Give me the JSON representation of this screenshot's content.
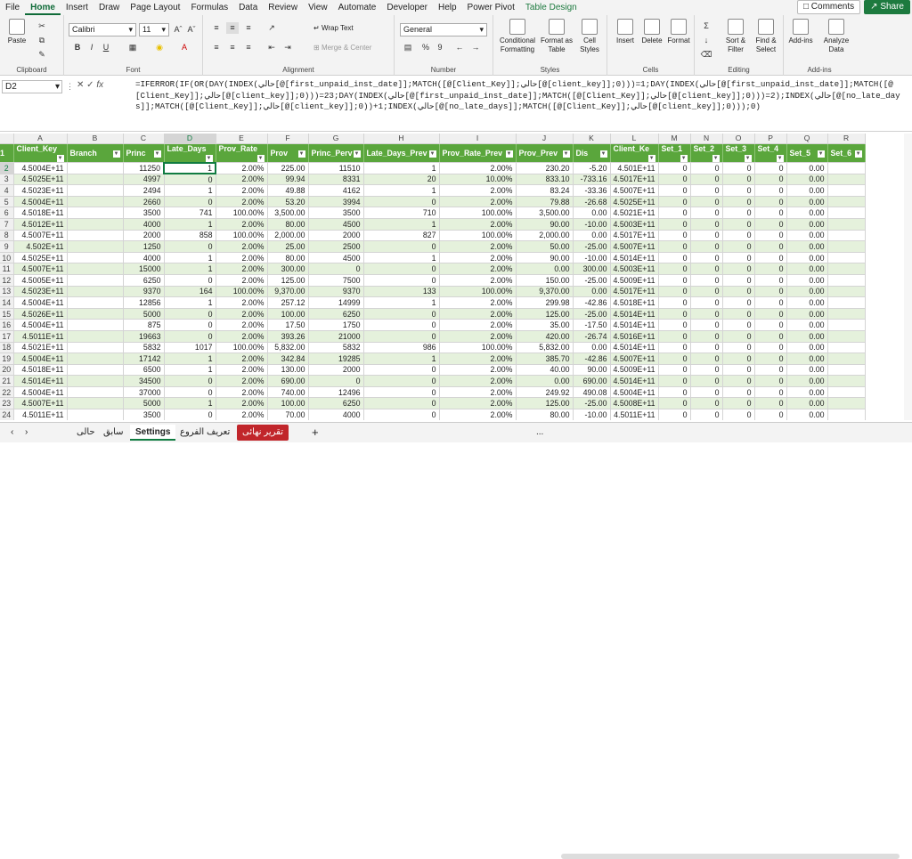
{
  "menu": {
    "tabs": [
      "File",
      "Home",
      "Insert",
      "Draw",
      "Page Layout",
      "Formulas",
      "Data",
      "Review",
      "View",
      "Automate",
      "Developer",
      "Help",
      "Power Pivot",
      "Table Design"
    ],
    "active": "Home",
    "comments": "Comments",
    "share": "Share"
  },
  "ribbon": {
    "clipboard": {
      "label": "Clipboard",
      "paste": "Paste"
    },
    "font": {
      "label": "Font",
      "name": "Calibri",
      "size": "11"
    },
    "alignment": {
      "label": "Alignment",
      "wrap": "Wrap Text",
      "merge": "Merge & Center"
    },
    "number": {
      "label": "Number",
      "format": "General",
      "pct": "%",
      "comma": "9"
    },
    "styles": {
      "label": "Styles",
      "cond": "Conditional Formatting",
      "fmt_table": "Format as Table",
      "cell_styles": "Cell Styles"
    },
    "cells": {
      "label": "Cells",
      "insert": "Insert",
      "delete": "Delete",
      "format": "Format"
    },
    "editing": {
      "label": "Editing",
      "sort": "Sort & Filter",
      "find": "Find & Select"
    },
    "addins": {
      "label": "Add-ins",
      "addins": "Add-ins",
      "analyze": "Analyze Data"
    }
  },
  "formula_bar": {
    "name_box": "D2",
    "fx": "fx",
    "formula": "=IFERROR(IF(OR(DAY(INDEX(حالي[@[first_unpaid_inst_date]];MATCH([@[Client_Key]];حالي[@[client_key]];0)))=1;DAY(INDEX(حالي[@[first_unpaid_inst_date]];MATCH([@[Client_Key]];حالي[@[client_key]];0)))=23;DAY(INDEX(حالي[@[first_unpaid_inst_date]];MATCH([@[Client_Key]];حالي[@[client_key]];0)))=2);INDEX(حالي[@[no_late_days]];MATCH([@[Client_Key]];حالي[@[client_key]];0))+1;INDEX(حالي[@[no_late_days]];MATCH([@[Client_Key]];حالي[@[client_key]];0)));0)"
  },
  "grid": {
    "columns": [
      "A",
      "B",
      "C",
      "D",
      "E",
      "F",
      "G",
      "H",
      "I",
      "J",
      "K",
      "L",
      "M",
      "N",
      "O",
      "P",
      "Q",
      "R"
    ],
    "headers": [
      "Client_Key",
      "Branch",
      "Princ",
      "Late_Days",
      "Prov_Rate",
      "Prov",
      "Princ_Perv",
      "Late_Days_Prev",
      "Prov_Rate_Prev",
      "Prov_Prev",
      "Dis",
      "Client_Ke",
      "Set_1",
      "Set_2",
      "Set_3",
      "Set_4",
      "Set_5",
      "Set_6"
    ],
    "rows": [
      [
        "4.5004E+11",
        "",
        "11250",
        "1",
        "2.00%",
        "225.00",
        "11510",
        "1",
        "2.00%",
        "230.20",
        "-5.20",
        "4.501E+11",
        "0",
        "0",
        "0",
        "0",
        "0.00",
        ""
      ],
      [
        "4.5025E+11",
        "",
        "4997",
        "0",
        "2.00%",
        "99.94",
        "8331",
        "20",
        "10.00%",
        "833.10",
        "-733.16",
        "4.5017E+11",
        "0",
        "0",
        "0",
        "0",
        "0.00",
        ""
      ],
      [
        "4.5023E+11",
        "",
        "2494",
        "1",
        "2.00%",
        "49.88",
        "4162",
        "1",
        "2.00%",
        "83.24",
        "-33.36",
        "4.5007E+11",
        "0",
        "0",
        "0",
        "0",
        "0.00",
        ""
      ],
      [
        "4.5004E+11",
        "",
        "2660",
        "0",
        "2.00%",
        "53.20",
        "3994",
        "0",
        "2.00%",
        "79.88",
        "-26.68",
        "4.5025E+11",
        "0",
        "0",
        "0",
        "0",
        "0.00",
        ""
      ],
      [
        "4.5018E+11",
        "",
        "3500",
        "741",
        "100.00%",
        "3,500.00",
        "3500",
        "710",
        "100.00%",
        "3,500.00",
        "0.00",
        "4.5021E+11",
        "0",
        "0",
        "0",
        "0",
        "0.00",
        ""
      ],
      [
        "4.5012E+11",
        "",
        "4000",
        "1",
        "2.00%",
        "80.00",
        "4500",
        "1",
        "2.00%",
        "90.00",
        "-10.00",
        "4.5003E+11",
        "0",
        "0",
        "0",
        "0",
        "0.00",
        ""
      ],
      [
        "4.5007E+11",
        "",
        "2000",
        "858",
        "100.00%",
        "2,000.00",
        "2000",
        "827",
        "100.00%",
        "2,000.00",
        "0.00",
        "4.5017E+11",
        "0",
        "0",
        "0",
        "0",
        "0.00",
        ""
      ],
      [
        "4.502E+11",
        "",
        "1250",
        "0",
        "2.00%",
        "25.00",
        "2500",
        "0",
        "2.00%",
        "50.00",
        "-25.00",
        "4.5007E+11",
        "0",
        "0",
        "0",
        "0",
        "0.00",
        ""
      ],
      [
        "4.5025E+11",
        "",
        "4000",
        "1",
        "2.00%",
        "80.00",
        "4500",
        "1",
        "2.00%",
        "90.00",
        "-10.00",
        "4.5014E+11",
        "0",
        "0",
        "0",
        "0",
        "0.00",
        ""
      ],
      [
        "4.5007E+11",
        "",
        "15000",
        "1",
        "2.00%",
        "300.00",
        "0",
        "0",
        "2.00%",
        "0.00",
        "300.00",
        "4.5003E+11",
        "0",
        "0",
        "0",
        "0",
        "0.00",
        ""
      ],
      [
        "4.5005E+11",
        "",
        "6250",
        "0",
        "2.00%",
        "125.00",
        "7500",
        "0",
        "2.00%",
        "150.00",
        "-25.00",
        "4.5009E+11",
        "0",
        "0",
        "0",
        "0",
        "0.00",
        ""
      ],
      [
        "4.5023E+11",
        "",
        "9370",
        "164",
        "100.00%",
        "9,370.00",
        "9370",
        "133",
        "100.00%",
        "9,370.00",
        "0.00",
        "4.5017E+11",
        "0",
        "0",
        "0",
        "0",
        "0.00",
        ""
      ],
      [
        "4.5004E+11",
        "",
        "12856",
        "1",
        "2.00%",
        "257.12",
        "14999",
        "1",
        "2.00%",
        "299.98",
        "-42.86",
        "4.5018E+11",
        "0",
        "0",
        "0",
        "0",
        "0.00",
        ""
      ],
      [
        "4.5026E+11",
        "",
        "5000",
        "0",
        "2.00%",
        "100.00",
        "6250",
        "0",
        "2.00%",
        "125.00",
        "-25.00",
        "4.5014E+11",
        "0",
        "0",
        "0",
        "0",
        "0.00",
        ""
      ],
      [
        "4.5004E+11",
        "",
        "875",
        "0",
        "2.00%",
        "17.50",
        "1750",
        "0",
        "2.00%",
        "35.00",
        "-17.50",
        "4.5014E+11",
        "0",
        "0",
        "0",
        "0",
        "0.00",
        ""
      ],
      [
        "4.5011E+11",
        "",
        "19663",
        "0",
        "2.00%",
        "393.26",
        "21000",
        "0",
        "2.00%",
        "420.00",
        "-26.74",
        "4.5016E+11",
        "0",
        "0",
        "0",
        "0",
        "0.00",
        ""
      ],
      [
        "4.5021E+11",
        "",
        "5832",
        "1017",
        "100.00%",
        "5,832.00",
        "5832",
        "986",
        "100.00%",
        "5,832.00",
        "0.00",
        "4.5014E+11",
        "0",
        "0",
        "0",
        "0",
        "0.00",
        ""
      ],
      [
        "4.5004E+11",
        "",
        "17142",
        "1",
        "2.00%",
        "342.84",
        "19285",
        "1",
        "2.00%",
        "385.70",
        "-42.86",
        "4.5007E+11",
        "0",
        "0",
        "0",
        "0",
        "0.00",
        ""
      ],
      [
        "4.5018E+11",
        "",
        "6500",
        "1",
        "2.00%",
        "130.00",
        "2000",
        "0",
        "2.00%",
        "40.00",
        "90.00",
        "4.5009E+11",
        "0",
        "0",
        "0",
        "0",
        "0.00",
        ""
      ],
      [
        "4.5014E+11",
        "",
        "34500",
        "0",
        "2.00%",
        "690.00",
        "0",
        "0",
        "2.00%",
        "0.00",
        "690.00",
        "4.5014E+11",
        "0",
        "0",
        "0",
        "0",
        "0.00",
        ""
      ],
      [
        "4.5004E+11",
        "",
        "37000",
        "0",
        "2.00%",
        "740.00",
        "12496",
        "0",
        "2.00%",
        "249.92",
        "490.08",
        "4.5004E+11",
        "0",
        "0",
        "0",
        "0",
        "0.00",
        ""
      ],
      [
        "4.5007E+11",
        "",
        "5000",
        "1",
        "2.00%",
        "100.00",
        "6250",
        "0",
        "2.00%",
        "125.00",
        "-25.00",
        "4.5008E+11",
        "0",
        "0",
        "0",
        "0",
        "0.00",
        ""
      ],
      [
        "4.5011E+11",
        "",
        "3500",
        "0",
        "2.00%",
        "70.00",
        "4000",
        "0",
        "2.00%",
        "80.00",
        "-10.00",
        "4.5011E+11",
        "0",
        "0",
        "0",
        "0",
        "0.00",
        ""
      ]
    ]
  },
  "sheets": {
    "tabs": [
      "...",
      "سابق",
      "حالى",
      "Settings",
      "تعريف الفروع",
      "تقرير نهائى"
    ],
    "active": "Settings",
    "add": "+"
  }
}
